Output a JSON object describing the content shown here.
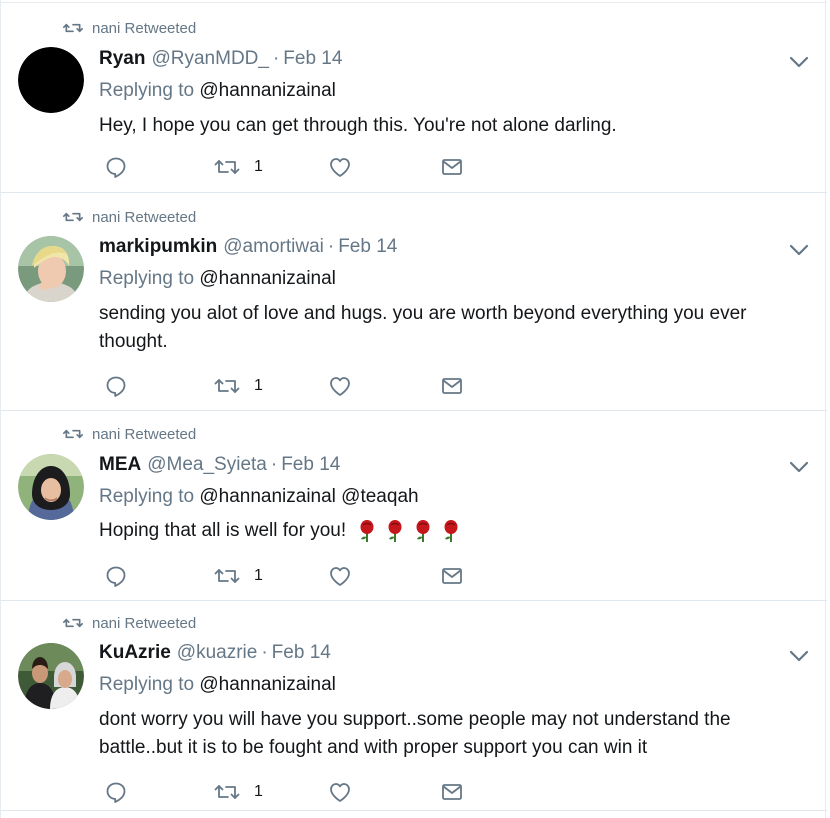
{
  "colors": {
    "secondary_text": "#657786",
    "primary_text": "#14171a",
    "divider": "#e1e8ed"
  },
  "tweets": [
    {
      "context": "nani Retweeted",
      "name": "Ryan",
      "handle": "@RyanMDD_",
      "separator": "·",
      "date": "Feb 14",
      "replying_prefix": "Replying to",
      "replying_to": "@hannanizainal",
      "text": "Hey, I hope you can get through this. You're not alone darling.",
      "retweet_count": "1",
      "avatar_icon": "black-circle-avatar"
    },
    {
      "context": "nani Retweeted",
      "name": "markipumkin",
      "handle": "@amortiwai",
      "separator": "·",
      "date": "Feb 14",
      "replying_prefix": "Replying to",
      "replying_to": "@hannanizainal",
      "text": "sending you alot of love and hugs. you are worth beyond everything you ever thought.",
      "retweet_count": "1",
      "avatar_icon": "blond-person-avatar"
    },
    {
      "context": "nani Retweeted",
      "name": "MEA",
      "handle": "@Mea_Syieta",
      "separator": "·",
      "date": "Feb 14",
      "replying_prefix": "Replying to",
      "replying_to": "@hannanizainal @teaqah",
      "text": "Hoping that all is well for you!",
      "emoji": "🌹🌹🌹🌹",
      "retweet_count": "1",
      "avatar_icon": "hijab-person-avatar"
    },
    {
      "context": "nani Retweeted",
      "name": "KuAzrie",
      "handle": "@kuazrie",
      "separator": "·",
      "date": "Feb 14",
      "replying_prefix": "Replying to",
      "replying_to": "@hannanizainal",
      "text": "dont worry you will have you support..some people may not understand the battle..but it is to be fought and with proper support you can win it",
      "retweet_count": "1",
      "avatar_icon": "couple-photo-avatar"
    }
  ]
}
